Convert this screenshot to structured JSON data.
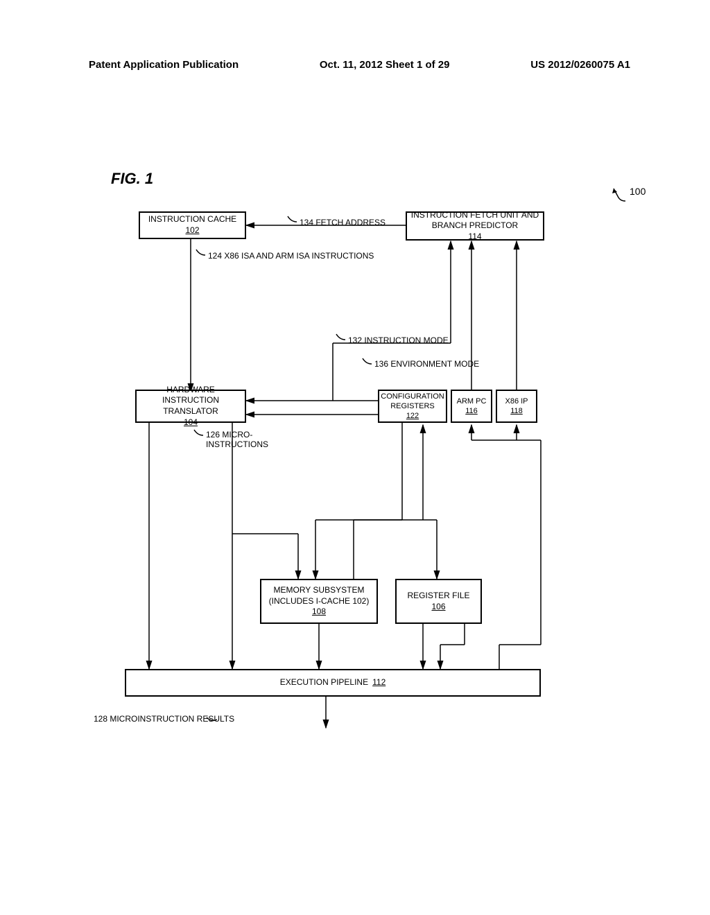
{
  "header": {
    "left": "Patent Application Publication",
    "center": "Oct. 11, 2012  Sheet 1 of 29",
    "right": "US 2012/0260075 A1"
  },
  "figure_label": "FIG. 1",
  "ref_100": "100",
  "boxes": {
    "instruction_cache": {
      "label": "INSTRUCTION CACHE",
      "ref": "102"
    },
    "fetch_unit": {
      "label": "INSTRUCTION FETCH UNIT AND BRANCH PREDICTOR",
      "ref": "114"
    },
    "translator": {
      "label": "HARDWARE INSTRUCTION TRANSLATOR",
      "ref": "104"
    },
    "config_reg": {
      "label": "CONFIGURATION REGISTERS",
      "ref": "122"
    },
    "arm_pc": {
      "label": "ARM PC",
      "ref": "116"
    },
    "x86_ip": {
      "label": "X86 IP",
      "ref": "118"
    },
    "memory": {
      "label1": "MEMORY SUBSYSTEM",
      "label2": "(INCLUDES I-CACHE 102)",
      "ref": "108"
    },
    "register_file": {
      "label": "REGISTER FILE",
      "ref": "106"
    },
    "pipeline": {
      "label": "EXECUTION PIPELINE",
      "ref": "112"
    }
  },
  "labels": {
    "fetch_addr": "134 FETCH ADDRESS",
    "x86_arm": "124 X86 ISA AND ARM ISA INSTRUCTIONS",
    "instr_mode": "132 INSTRUCTION MODE",
    "env_mode": "136 ENVIRONMENT MODE",
    "micro_instr": "126 MICRO-\nINSTRUCTIONS",
    "micro_results": "128 MICROINSTRUCTION RESULTS"
  }
}
